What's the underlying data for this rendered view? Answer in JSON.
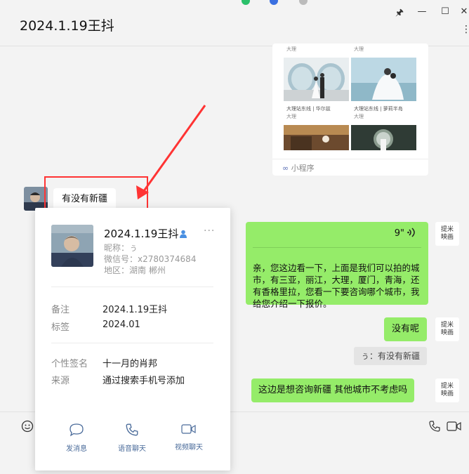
{
  "window": {
    "title": "2024.1.19王抖",
    "controls": {
      "pin": "🖈",
      "minimize": "—",
      "maximize": "☐",
      "close": "✕"
    },
    "more": "⋮"
  },
  "mini_program": {
    "top_captions": [
      "大理",
      "大理"
    ],
    "items": [
      {
        "title": "大理站东线 | 华尔兹",
        "caption": "大理"
      },
      {
        "title": "大理站东线 | 萝莉半岛",
        "caption": "大理"
      }
    ],
    "label": "小程序"
  },
  "messages": {
    "left_text": "有没有新疆",
    "voice_duration": "9\"",
    "voice_icon": "((·",
    "voice_transcript": "亲，您这边看一下，上面是我们可以拍的城市，有三亚，丽江，大理，厦门，青海，还有香格里拉，您看一下要咨询哪个城市，我给您介绍一下报价。",
    "reply_1": "没有呢",
    "quote": "ぅ：有没有新疆",
    "reply_2": "这边是想咨询新疆  其他城市不考虑吗",
    "brand_avatar": "提米\n映画"
  },
  "profile": {
    "name": "2024.1.19王抖",
    "nickname": "昵称：ぅ",
    "wechat_id": "微信号：x2780374684",
    "region": "地区：湖南  郴州",
    "more": "···",
    "fields": [
      {
        "key": "备注",
        "value": "2024.1.19王抖"
      },
      {
        "key": "标签",
        "value": "2024.01"
      },
      {
        "key": "个性签名",
        "value": "十一月的肖邦"
      },
      {
        "key": "来源",
        "value": "通过搜索手机号添加"
      }
    ],
    "actions": [
      "发消息",
      "语音聊天",
      "视频聊天"
    ]
  },
  "colors": {
    "bubble_green": "#95ec69",
    "annotation_red": "#ff3333",
    "link_blue": "#4a6b9a"
  }
}
